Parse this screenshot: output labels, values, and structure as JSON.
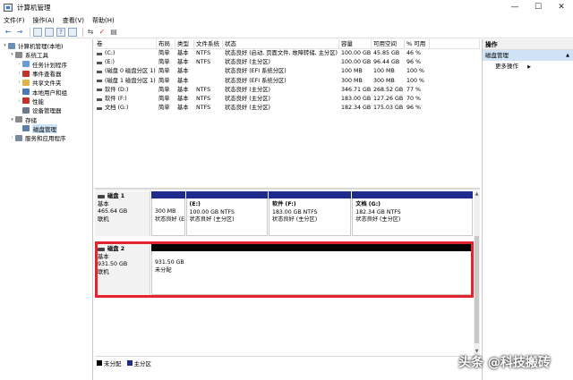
{
  "window": {
    "title": "计算机管理"
  },
  "menu": [
    "文件(F)",
    "操作(A)",
    "查看(V)",
    "帮助(H)"
  ],
  "tree": [
    {
      "label": "计算机管理(本地)",
      "indent": 0,
      "arrow": "▾",
      "color": "#6b8fb8"
    },
    {
      "label": "系统工具",
      "indent": 1,
      "arrow": "▾",
      "color": "#8a8a8a"
    },
    {
      "label": "任务计划程序",
      "indent": 2,
      "arrow": "›",
      "color": "#6a9ad8"
    },
    {
      "label": "事件查看器",
      "indent": 2,
      "arrow": "›",
      "color": "#c9302c"
    },
    {
      "label": "共享文件夹",
      "indent": 2,
      "arrow": "›",
      "color": "#e3b341"
    },
    {
      "label": "本地用户和组",
      "indent": 2,
      "arrow": "›",
      "color": "#4a78b8"
    },
    {
      "label": "性能",
      "indent": 2,
      "arrow": "›",
      "color": "#c9302c"
    },
    {
      "label": "设备管理器",
      "indent": 2,
      "arrow": "",
      "color": "#6a7a8a"
    },
    {
      "label": "存储",
      "indent": 1,
      "arrow": "▾",
      "color": "#8a8a8a"
    },
    {
      "label": "磁盘管理",
      "indent": 2,
      "arrow": "",
      "color": "#5b7fa8",
      "selected": true
    },
    {
      "label": "服务和应用程序",
      "indent": 1,
      "arrow": "›",
      "color": "#7a8aa0"
    }
  ],
  "table": {
    "headers": [
      "卷",
      "布局",
      "类型",
      "文件系统",
      "状态",
      "容量",
      "可用空间",
      "% 可用"
    ],
    "rows": [
      [
        "(C:)",
        "简单",
        "基本",
        "NTFS",
        "状态良好 (启动, 页面文件, 故障转储, 主分区)",
        "100.00 GB",
        "45.85 GB",
        "46 %"
      ],
      [
        "(E:)",
        "简单",
        "基本",
        "NTFS",
        "状态良好 (主分区)",
        "100.00 GB",
        "96.44 GB",
        "96 %"
      ],
      [
        "(磁盘 0 磁盘分区 1)",
        "简单",
        "基本",
        "",
        "状态良好 (EFI 系统分区)",
        "100 MB",
        "100 MB",
        "100 %"
      ],
      [
        "(磁盘 1 磁盘分区 1)",
        "简单",
        "基本",
        "",
        "状态良好 (EFI 系统分区)",
        "300 MB",
        "300 MB",
        "100 %"
      ],
      [
        "软件 (D:)",
        "简单",
        "基本",
        "NTFS",
        "状态良好 (主分区)",
        "346.71 GB",
        "268.52 GB",
        "77 %"
      ],
      [
        "软件 (F:)",
        "简单",
        "基本",
        "NTFS",
        "状态良好 (主分区)",
        "183.00 GB",
        "127.26 GB",
        "70 %"
      ],
      [
        "文档 (G:)",
        "简单",
        "基本",
        "NTFS",
        "状态良好 (主分区)",
        "182.34 GB",
        "175.03 GB",
        "96 %"
      ]
    ]
  },
  "disk1": {
    "name": "磁盘 1",
    "type": "基本",
    "size": "465.64 GB",
    "status": "联机",
    "partitions": [
      {
        "name": "",
        "size": "300 MB",
        "status": "状态良好 (EF",
        "share": 0.107
      },
      {
        "name": "(E:)",
        "size": "100.00 GB NTFS",
        "status": "状态良好 (主分区)",
        "share": 0.257
      },
      {
        "name": "软件 (F:)",
        "size": "183.00 GB NTFS",
        "status": "状态良好 (主分区)",
        "share": 0.259
      },
      {
        "name": "文档 (G:)",
        "size": "182.34 GB NTFS",
        "status": "状态良好 (主分区)",
        "share": 0.377
      }
    ]
  },
  "disk2": {
    "name": "磁盘 2",
    "type": "基本",
    "size": "931.50 GB",
    "status": "联机",
    "partition": {
      "size": "931.50 GB",
      "status": "未分配"
    }
  },
  "legend": {
    "unallocated": "未分配",
    "primary": "主分区"
  },
  "actions": {
    "header": "操作",
    "group": "磁盘管理",
    "more": "更多操作"
  },
  "watermark": "头条 @科技搬砖",
  "colors": {
    "primary_partition": "#1f2a8c",
    "unallocated": "#000000",
    "highlight": "#e4242f",
    "selection": "#cce4f7"
  }
}
